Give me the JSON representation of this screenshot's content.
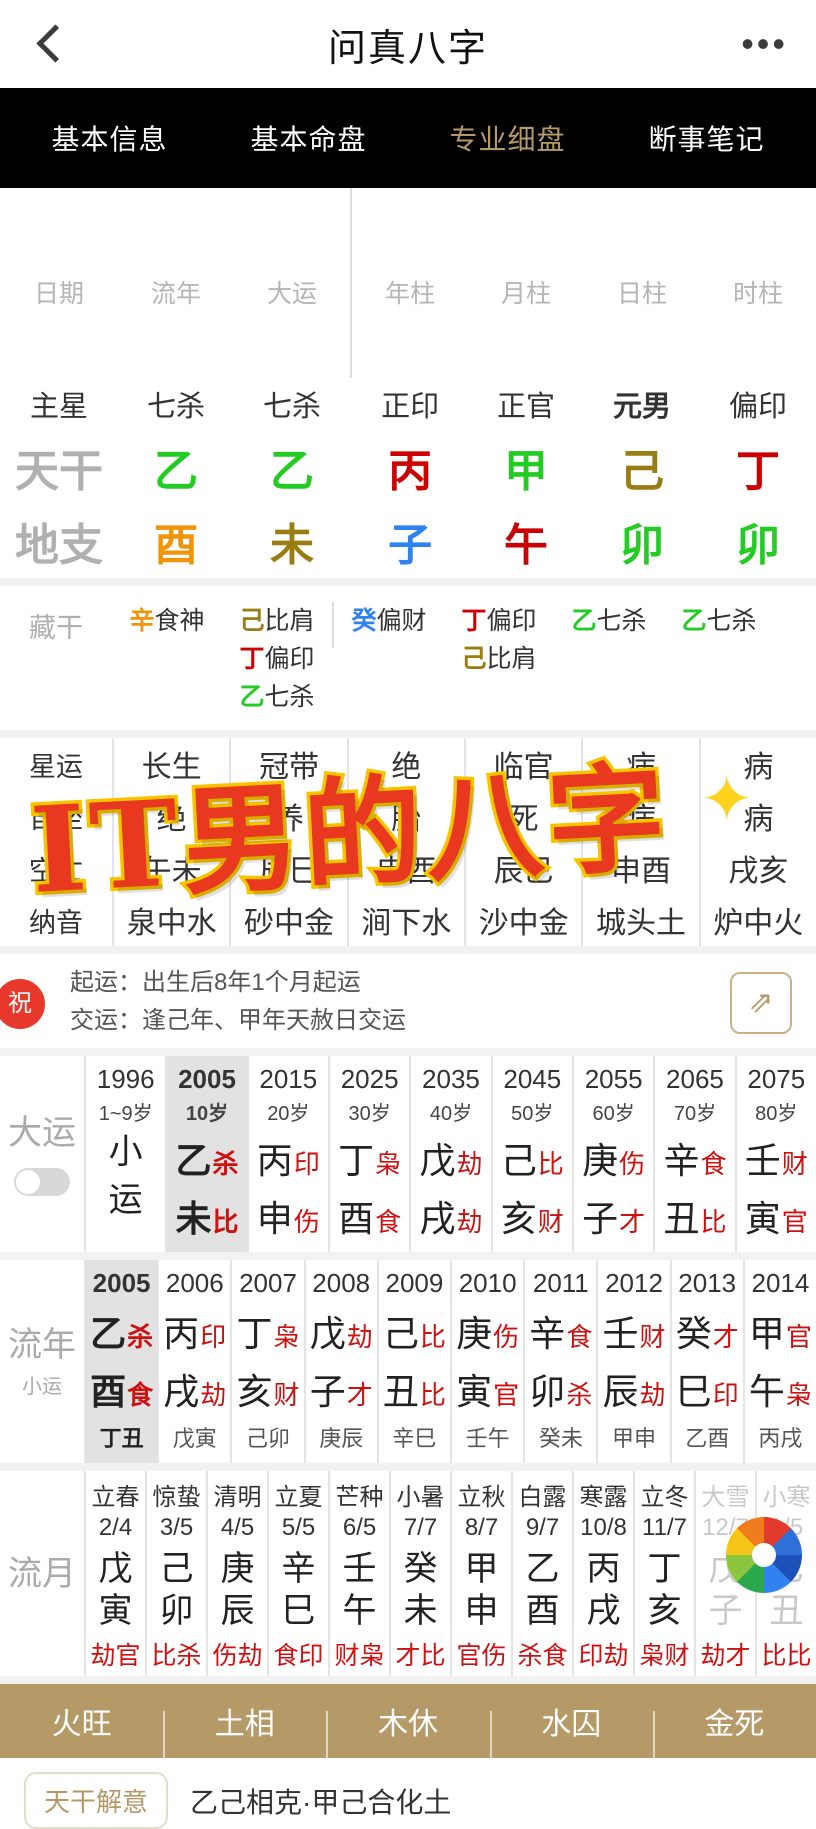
{
  "nav": {
    "back_icon": "chevron-left-icon",
    "title": "问真八字",
    "more_icon": "ellipsis-icon"
  },
  "tabs": [
    {
      "label": "基本信息",
      "active": false
    },
    {
      "label": "基本命盘",
      "active": false
    },
    {
      "label": "专业细盘",
      "active": true
    },
    {
      "label": "断事笔记",
      "active": false
    }
  ],
  "pillar_table": {
    "row_labels": [
      "日期",
      "主星",
      "天干",
      "地支",
      "藏干",
      "星运",
      "自坐",
      "空亡",
      "纳音"
    ],
    "columns": [
      {
        "header": "流年",
        "main_star": "七杀",
        "stem": "乙",
        "stem_el": "wood",
        "branch": "酉",
        "branch_el": "metal",
        "hidden": [
          {
            "g": "辛",
            "g_el": "metal",
            "t": "食神"
          }
        ],
        "xingyun": "长生",
        "zizuo": "绝",
        "kongwang": "午未",
        "nayin": "泉中水"
      },
      {
        "header": "大运",
        "main_star": "七杀",
        "stem": "乙",
        "stem_el": "wood",
        "branch": "未",
        "branch_el": "earth",
        "hidden": [
          {
            "g": "己",
            "g_el": "earth",
            "t": "比肩"
          },
          {
            "g": "丁",
            "g_el": "fire",
            "t": "偏印"
          },
          {
            "g": "乙",
            "g_el": "wood",
            "t": "七杀"
          }
        ],
        "xingyun": "冠带",
        "zizuo": "养",
        "kongwang": "辰巳",
        "nayin": "砂中金"
      },
      {
        "header": "年柱",
        "main_star": "正印",
        "stem": "丙",
        "stem_el": "fire",
        "branch": "子",
        "branch_el": "water",
        "hidden": [
          {
            "g": "癸",
            "g_el": "water",
            "t": "偏财"
          }
        ],
        "xingyun": "绝",
        "zizuo": "胎",
        "kongwang": "申酉",
        "nayin": "涧下水"
      },
      {
        "header": "月柱",
        "main_star": "正官",
        "stem": "甲",
        "stem_el": "wood",
        "branch": "午",
        "branch_el": "fire",
        "hidden": [
          {
            "g": "丁",
            "g_el": "fire",
            "t": "偏印"
          },
          {
            "g": "己",
            "g_el": "earth",
            "t": "比肩"
          }
        ],
        "xingyun": "临官",
        "zizuo": "死",
        "kongwang": "辰巳",
        "nayin": "沙中金"
      },
      {
        "header": "日柱",
        "main_star": "元男",
        "stem": "己",
        "stem_el": "earth",
        "branch": "卯",
        "branch_el": "wood",
        "hidden": [
          {
            "g": "乙",
            "g_el": "wood",
            "t": "七杀"
          }
        ],
        "xingyun": "病",
        "zizuo": "病",
        "kongwang": "申酉",
        "nayin": "城头土"
      },
      {
        "header": "时柱",
        "main_star": "偏印",
        "stem": "丁",
        "stem_el": "fire",
        "branch": "卯",
        "branch_el": "wood",
        "hidden": [
          {
            "g": "乙",
            "g_el": "wood",
            "t": "七杀"
          }
        ],
        "xingyun": "病",
        "zizuo": "病",
        "kongwang": "戌亥",
        "nayin": "炉中火"
      }
    ]
  },
  "info_strip": {
    "badge": "祝",
    "line1": "起运：出生后8年1个月起运",
    "line2": "交运：逢己年、甲年天赦日交运",
    "share_icon": "share-square-icon"
  },
  "dayun": {
    "label": "大运",
    "toggle_icon": "toggle-switch-off",
    "columns": [
      {
        "year": "1996",
        "age": "1~9岁",
        "stem": "小",
        "stem_god": "",
        "branch": "运",
        "branch_god": "",
        "selected": false,
        "is_xiaoyun": true
      },
      {
        "year": "2005",
        "age": "10岁",
        "stem": "乙",
        "stem_god": "杀",
        "branch": "未",
        "branch_god": "比",
        "selected": true
      },
      {
        "year": "2015",
        "age": "20岁",
        "stem": "丙",
        "stem_god": "印",
        "branch": "申",
        "branch_god": "伤",
        "selected": false
      },
      {
        "year": "2025",
        "age": "30岁",
        "stem": "丁",
        "stem_god": "枭",
        "branch": "酉",
        "branch_god": "食",
        "selected": false
      },
      {
        "year": "2035",
        "age": "40岁",
        "stem": "戊",
        "stem_god": "劫",
        "branch": "戌",
        "branch_god": "劫",
        "selected": false
      },
      {
        "year": "2045",
        "age": "50岁",
        "stem": "己",
        "stem_god": "比",
        "branch": "亥",
        "branch_god": "财",
        "selected": false
      },
      {
        "year": "2055",
        "age": "60岁",
        "stem": "庚",
        "stem_god": "伤",
        "branch": "子",
        "branch_god": "才",
        "selected": false
      },
      {
        "year": "2065",
        "age": "70岁",
        "stem": "辛",
        "stem_god": "食",
        "branch": "丑",
        "branch_god": "比",
        "selected": false
      },
      {
        "year": "2075",
        "age": "80岁",
        "stem": "壬",
        "stem_god": "财",
        "branch": "寅",
        "branch_god": "官",
        "selected": false
      }
    ]
  },
  "liunian": {
    "label_big": "流年",
    "label_small": "小运",
    "columns": [
      {
        "year": "2005",
        "stem": "乙",
        "stem_god": "杀",
        "branch": "酉",
        "branch_god": "食",
        "xiaoyun": "丁丑",
        "selected": true
      },
      {
        "year": "2006",
        "stem": "丙",
        "stem_god": "印",
        "branch": "戌",
        "branch_god": "劫",
        "xiaoyun": "戊寅",
        "selected": false
      },
      {
        "year": "2007",
        "stem": "丁",
        "stem_god": "枭",
        "branch": "亥",
        "branch_god": "财",
        "xiaoyun": "己卯",
        "selected": false
      },
      {
        "year": "2008",
        "stem": "戊",
        "stem_god": "劫",
        "branch": "子",
        "branch_god": "才",
        "xiaoyun": "庚辰",
        "selected": false
      },
      {
        "year": "2009",
        "stem": "己",
        "stem_god": "比",
        "branch": "丑",
        "branch_god": "比",
        "xiaoyun": "辛巳",
        "selected": false
      },
      {
        "year": "2010",
        "stem": "庚",
        "stem_god": "伤",
        "branch": "寅",
        "branch_god": "官",
        "xiaoyun": "壬午",
        "selected": false
      },
      {
        "year": "2011",
        "stem": "辛",
        "stem_god": "食",
        "branch": "卯",
        "branch_god": "杀",
        "xiaoyun": "癸未",
        "selected": false
      },
      {
        "year": "2012",
        "stem": "壬",
        "stem_god": "财",
        "branch": "辰",
        "branch_god": "劫",
        "xiaoyun": "甲申",
        "selected": false
      },
      {
        "year": "2013",
        "stem": "癸",
        "stem_god": "才",
        "branch": "巳",
        "branch_god": "印",
        "xiaoyun": "乙酉",
        "selected": false
      },
      {
        "year": "2014",
        "stem": "甲",
        "stem_god": "官",
        "branch": "午",
        "branch_god": "枭",
        "xiaoyun": "丙戌",
        "selected": false
      }
    ]
  },
  "liuyue": {
    "label": "流月",
    "columns": [
      {
        "term": "立春",
        "date": "2/4",
        "stem": "戊",
        "branch": "寅",
        "ten": "劫官",
        "dim": false
      },
      {
        "term": "惊蛰",
        "date": "3/5",
        "stem": "己",
        "branch": "卯",
        "ten": "比杀",
        "dim": false
      },
      {
        "term": "清明",
        "date": "4/5",
        "stem": "庚",
        "branch": "辰",
        "ten": "伤劫",
        "dim": false
      },
      {
        "term": "立夏",
        "date": "5/5",
        "stem": "辛",
        "branch": "巳",
        "ten": "食印",
        "dim": false
      },
      {
        "term": "芒种",
        "date": "6/5",
        "stem": "壬",
        "branch": "午",
        "ten": "财枭",
        "dim": false
      },
      {
        "term": "小暑",
        "date": "7/7",
        "stem": "癸",
        "branch": "未",
        "ten": "才比",
        "dim": false
      },
      {
        "term": "立秋",
        "date": "8/7",
        "stem": "甲",
        "branch": "申",
        "ten": "官伤",
        "dim": false
      },
      {
        "term": "白露",
        "date": "9/7",
        "stem": "乙",
        "branch": "酉",
        "ten": "杀食",
        "dim": false
      },
      {
        "term": "寒露",
        "date": "10/8",
        "stem": "丙",
        "branch": "戌",
        "ten": "印劫",
        "dim": false
      },
      {
        "term": "立冬",
        "date": "11/7",
        "stem": "丁",
        "branch": "亥",
        "ten": "枭财",
        "dim": false
      },
      {
        "term": "大雪",
        "date": "12/7",
        "stem": "戊",
        "branch": "子",
        "ten": "劫才",
        "dim": true
      },
      {
        "term": "小寒",
        "date": "1/5",
        "stem": "己",
        "branch": "丑",
        "ten": "比比",
        "dim": true
      }
    ],
    "wheel_icon": "color-wheel-icon"
  },
  "five_elements_bar": [
    "火旺",
    "土相",
    "木休",
    "水囚",
    "金死"
  ],
  "footer": {
    "button_label": "天干解意",
    "text": "乙己相克·甲己合化土"
  },
  "watermark": {
    "text": "IT男的八字",
    "star_icon": "sparkle-star-icon"
  },
  "colors": {
    "wood": "#22cc22",
    "fire": "#cc0000",
    "earth": "#9a7d12",
    "metal": "#f0940c",
    "water": "#2f82f0",
    "accent_gold": "#b59a68",
    "ten_god_red": "#cc1111",
    "watermark_red": "#e8381f",
    "watermark_outline": "#f8c400"
  }
}
